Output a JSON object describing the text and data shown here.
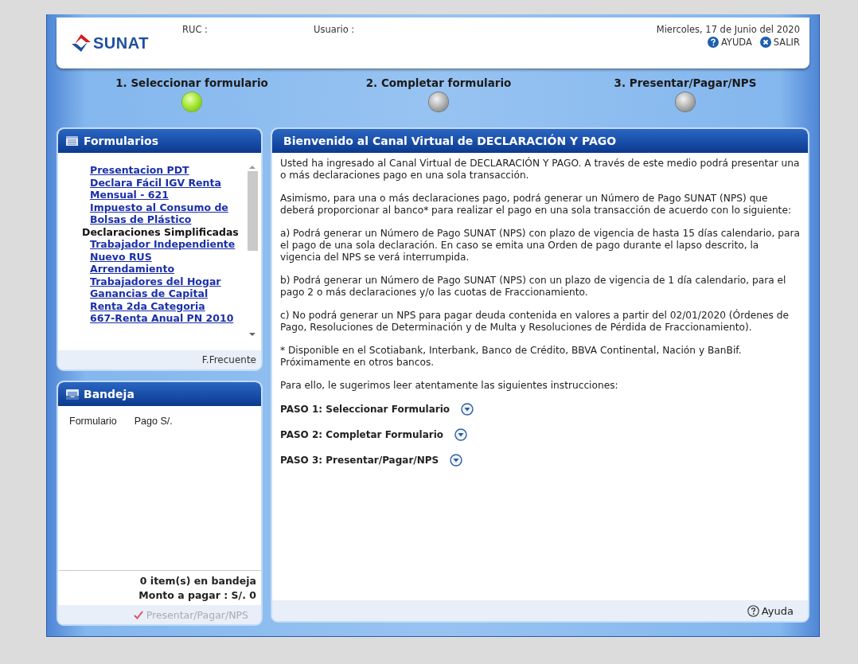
{
  "header": {
    "logo": "SUNAT",
    "ruc_label": "RUC :",
    "user_label": "Usuario :",
    "date": "Miercoles, 17 de Junio del 2020",
    "links": [
      {
        "kind": "help",
        "label": "AYUDA"
      },
      {
        "kind": "exit",
        "label": "SALIR"
      }
    ]
  },
  "steps": [
    {
      "label": "1. Seleccionar formulario",
      "selected": true
    },
    {
      "label": "2. Completar formulario",
      "selected": false
    },
    {
      "label": "3. Presentar/Pagar/NPS",
      "selected": false
    }
  ],
  "formularios": {
    "title": "Formularios",
    "items": [
      {
        "kind": "link",
        "text": "Presentacion PDT"
      },
      {
        "kind": "link",
        "text": "Declara Fácil IGV Renta Mensual - 621"
      },
      {
        "kind": "link",
        "text": "Impuesto al Consumo de Bolsas de Plástico"
      },
      {
        "kind": "heading",
        "text": "Declaraciones Simplificadas"
      },
      {
        "kind": "link",
        "text": "Trabajador Independiente"
      },
      {
        "kind": "link",
        "text": "Nuevo RUS"
      },
      {
        "kind": "link",
        "text": "Arrendamiento"
      },
      {
        "kind": "link",
        "text": "Trabajadores del Hogar"
      },
      {
        "kind": "link",
        "text": "Ganancias de Capital"
      },
      {
        "kind": "link",
        "text": "Renta 2da Categoria"
      },
      {
        "kind": "link",
        "text": "667-Renta Anual PN 2010"
      }
    ],
    "footer": "F.Frecuente"
  },
  "bandeja": {
    "title": "Bandeja",
    "columns": [
      "Formulario",
      "Pago S/."
    ],
    "count": "0 item(s) en bandeja",
    "total": "Monto a pagar : S/. 0",
    "button": {
      "label": "Presentar/Pagar/NPS",
      "disabled": true
    }
  },
  "main": {
    "title": "Bienvenido al Canal Virtual de DECLARACIÓN Y PAGO",
    "paragraphs": [
      "Usted ha ingresado al Canal Virtual de DECLARACIÓN Y PAGO. A través de este medio podrá presentar una o más declaraciones pago en una sola transacción.",
      "Asimismo, para una o más declaraciones pago, podrá generar un Número de Pago SUNAT (NPS) que deberá proporcionar al banco* para realizar el pago en una sola transacción de acuerdo con lo siguiente:",
      "a) Podrá generar un Número de Pago SUNAT (NPS) con plazo de vigencia de hasta 15 días calendario, para el pago de una sola declaración. En caso se emita una Orden de pago durante el lapso descrito, la vigencia del NPS se verá interrumpida.",
      "b) Podrá generar un Número de Pago SUNAT (NPS) con un plazo de vigencia de 1 día calendario, para el pago 2 o más declaraciones y/o las cuotas de Fraccionamiento.",
      "c) No podrá generar un NPS para pagar deuda contenida en valores a partir del 02/01/2020 (Órdenes de Pago, Resoluciones de Determinación y de Multa y Resoluciones de Pérdida de Fraccionamiento).",
      "* Disponible en el Scotiabank, Interbank, Banco de Crédito, BBVA Continental, Nación y BanBif. Próximamente en otros bancos.",
      "Para ello, le sugerimos leer atentamente las siguientes instrucciones:"
    ],
    "steps": [
      {
        "label": "PASO 1: Seleccionar Formulario",
        "expanded": false
      },
      {
        "label": "PASO 2: Completar Formulario",
        "expanded": false
      },
      {
        "label": "PASO 3: Presentar/Pagar/NPS",
        "expanded": false
      }
    ],
    "help": "Ayuda"
  }
}
